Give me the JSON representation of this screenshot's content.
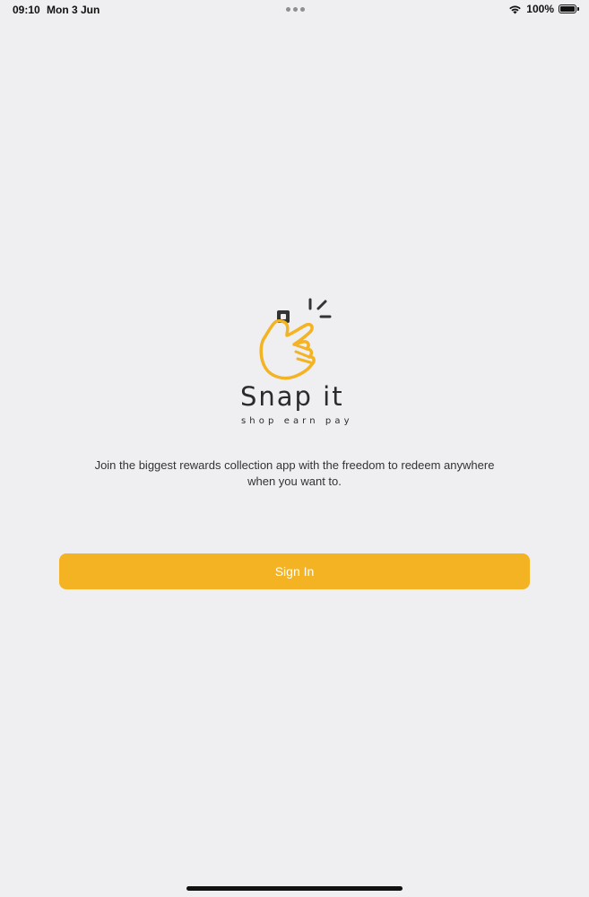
{
  "status_bar": {
    "time": "09:10",
    "date": "Mon 3 Jun",
    "battery": "100%",
    "icons": [
      "wifi-icon",
      "battery-icon"
    ]
  },
  "logo": {
    "title": "Snap it",
    "tagline": "shop earn pay",
    "icon": "snapping-hand-icon",
    "accent_color": "#f3b323",
    "dark_color": "#333333"
  },
  "welcome": {
    "description_line1": "Join the biggest rewards collection app with the freedom to redeem anywhere",
    "description_line2": "when you want to."
  },
  "actions": {
    "sign_in_label": "Sign In",
    "button_color": "#f3b323"
  }
}
